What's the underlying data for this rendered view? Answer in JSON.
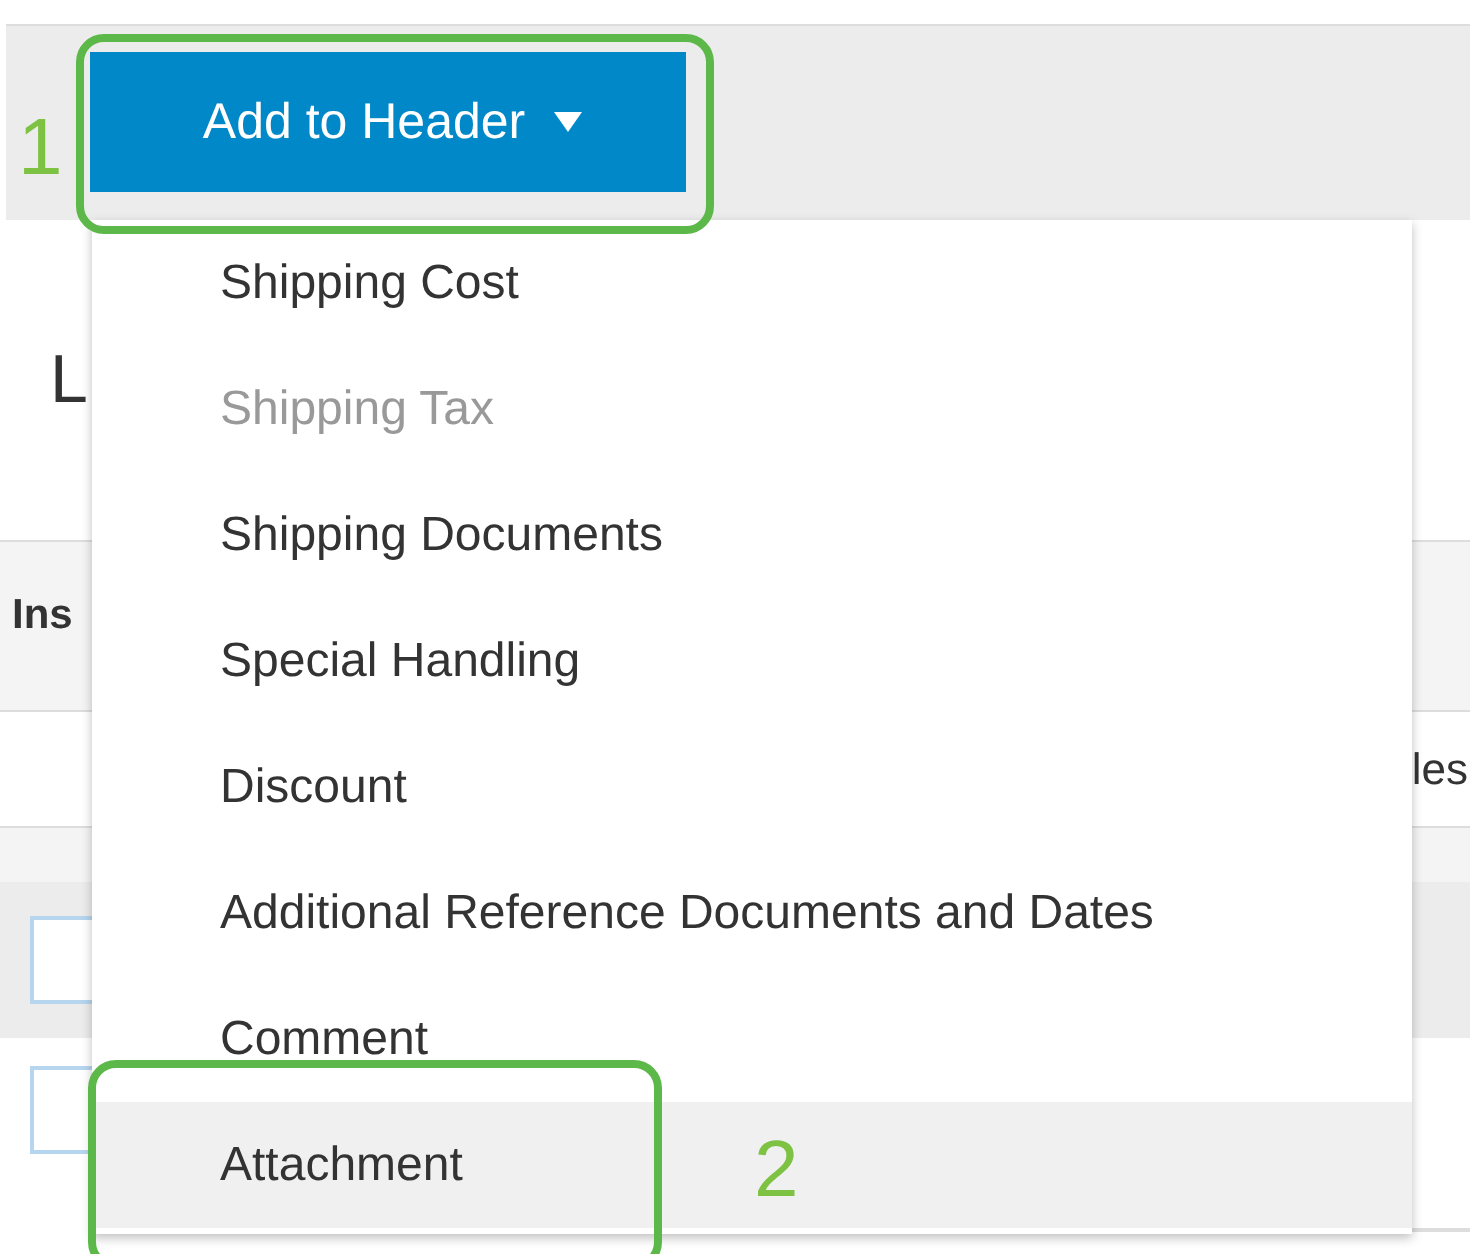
{
  "toolbar": {
    "button": {
      "label": "Add to Header",
      "expanded": true
    }
  },
  "menu": {
    "items": [
      {
        "label": "Shipping Cost",
        "disabled": false,
        "selected": false
      },
      {
        "label": "Shipping Tax",
        "disabled": true,
        "selected": false
      },
      {
        "label": "Shipping Documents",
        "disabled": false,
        "selected": false
      },
      {
        "label": "Special Handling",
        "disabled": false,
        "selected": false
      },
      {
        "label": "Discount",
        "disabled": false,
        "selected": false
      },
      {
        "label": "Additional Reference Documents and Dates",
        "disabled": false,
        "selected": false
      },
      {
        "label": "Comment",
        "disabled": false,
        "selected": false
      },
      {
        "label": "Attachment",
        "disabled": false,
        "selected": true
      }
    ]
  },
  "page": {
    "heading": "L",
    "column_header": "Ins",
    "field_text": "les",
    "rows": [
      {
        "checked": false
      },
      {
        "checked": false
      }
    ]
  },
  "callouts": [
    {
      "label": "1"
    },
    {
      "label": "2"
    }
  ]
}
